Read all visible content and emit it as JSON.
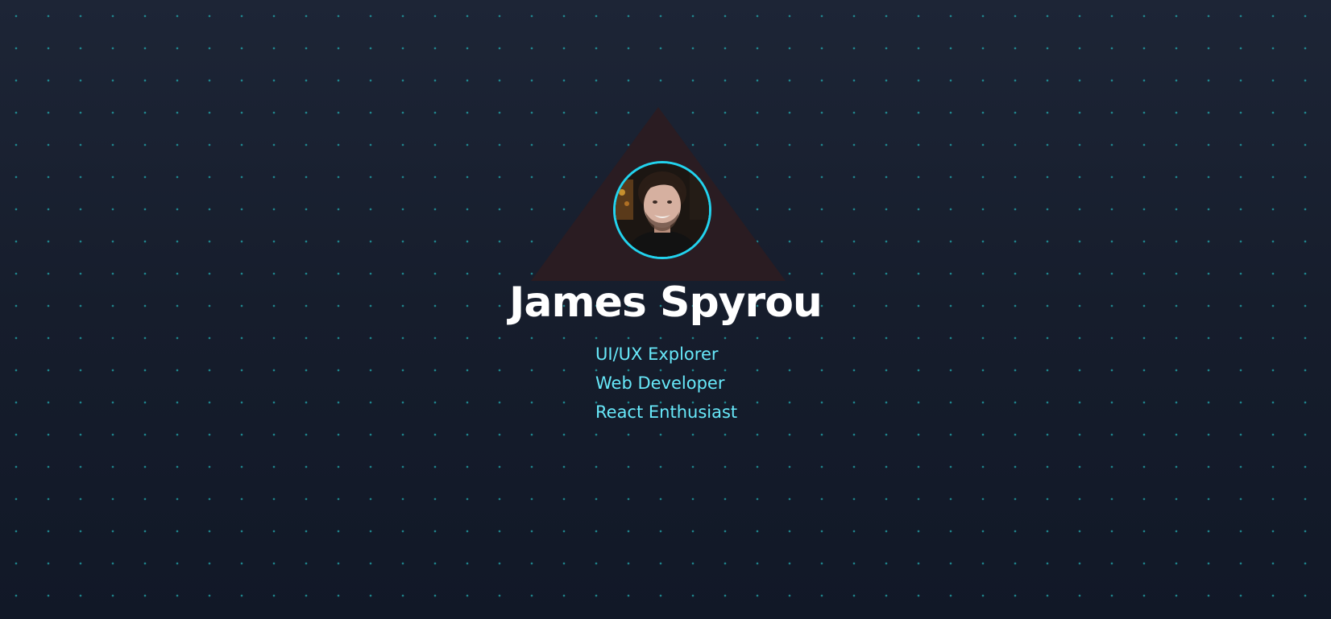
{
  "profile": {
    "name": "James Spyrou",
    "avatar_alt": "James Spyrou",
    "roles": [
      "UI/UX Explorer",
      "Web Developer",
      "React Enthusiast"
    ]
  },
  "colors": {
    "background": "#141a28",
    "dot_grid": "#22aaaf",
    "triangle": "#2a1c22",
    "avatar_ring": "#22d3ee",
    "name_text": "#ffffff",
    "role_text": "#67e8f9"
  }
}
